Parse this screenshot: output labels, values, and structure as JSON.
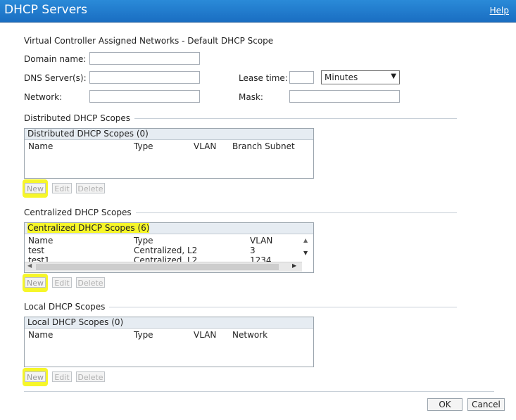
{
  "window": {
    "title": "DHCP Servers",
    "help": "Help"
  },
  "default_scope": {
    "heading": "Virtual Controller Assigned Networks - Default DHCP Scope",
    "domain_label": "Domain name:",
    "dns_label": "DNS Server(s):",
    "lease_label": "Lease time:",
    "lease_unit": "Minutes",
    "network_label": "Network:",
    "mask_label": "Mask:"
  },
  "distributed": {
    "section_title": "Distributed DHCP Scopes",
    "caption": "Distributed DHCP Scopes (0)",
    "columns": [
      "Name",
      "Type",
      "VLAN",
      "Branch Subnet"
    ]
  },
  "centralized": {
    "section_title": "Centralized DHCP Scopes",
    "caption": "Centralized DHCP Scopes (6)",
    "columns": [
      "Name",
      "Type",
      "VLAN"
    ],
    "rows": [
      [
        "test",
        "Centralized, L2",
        "3"
      ],
      [
        "test1",
        "Centralized, L2",
        "1234"
      ]
    ]
  },
  "local": {
    "section_title": "Local DHCP Scopes",
    "caption": "Local DHCP Scopes (0)",
    "columns": [
      "Name",
      "Type",
      "VLAN",
      "Network"
    ]
  },
  "buttons": {
    "new": "New",
    "edit": "Edit",
    "delete": "Delete",
    "ok": "OK",
    "cancel": "Cancel"
  },
  "colors": {
    "title_bar": "#1a6ec2",
    "highlight": "#f6f629"
  }
}
